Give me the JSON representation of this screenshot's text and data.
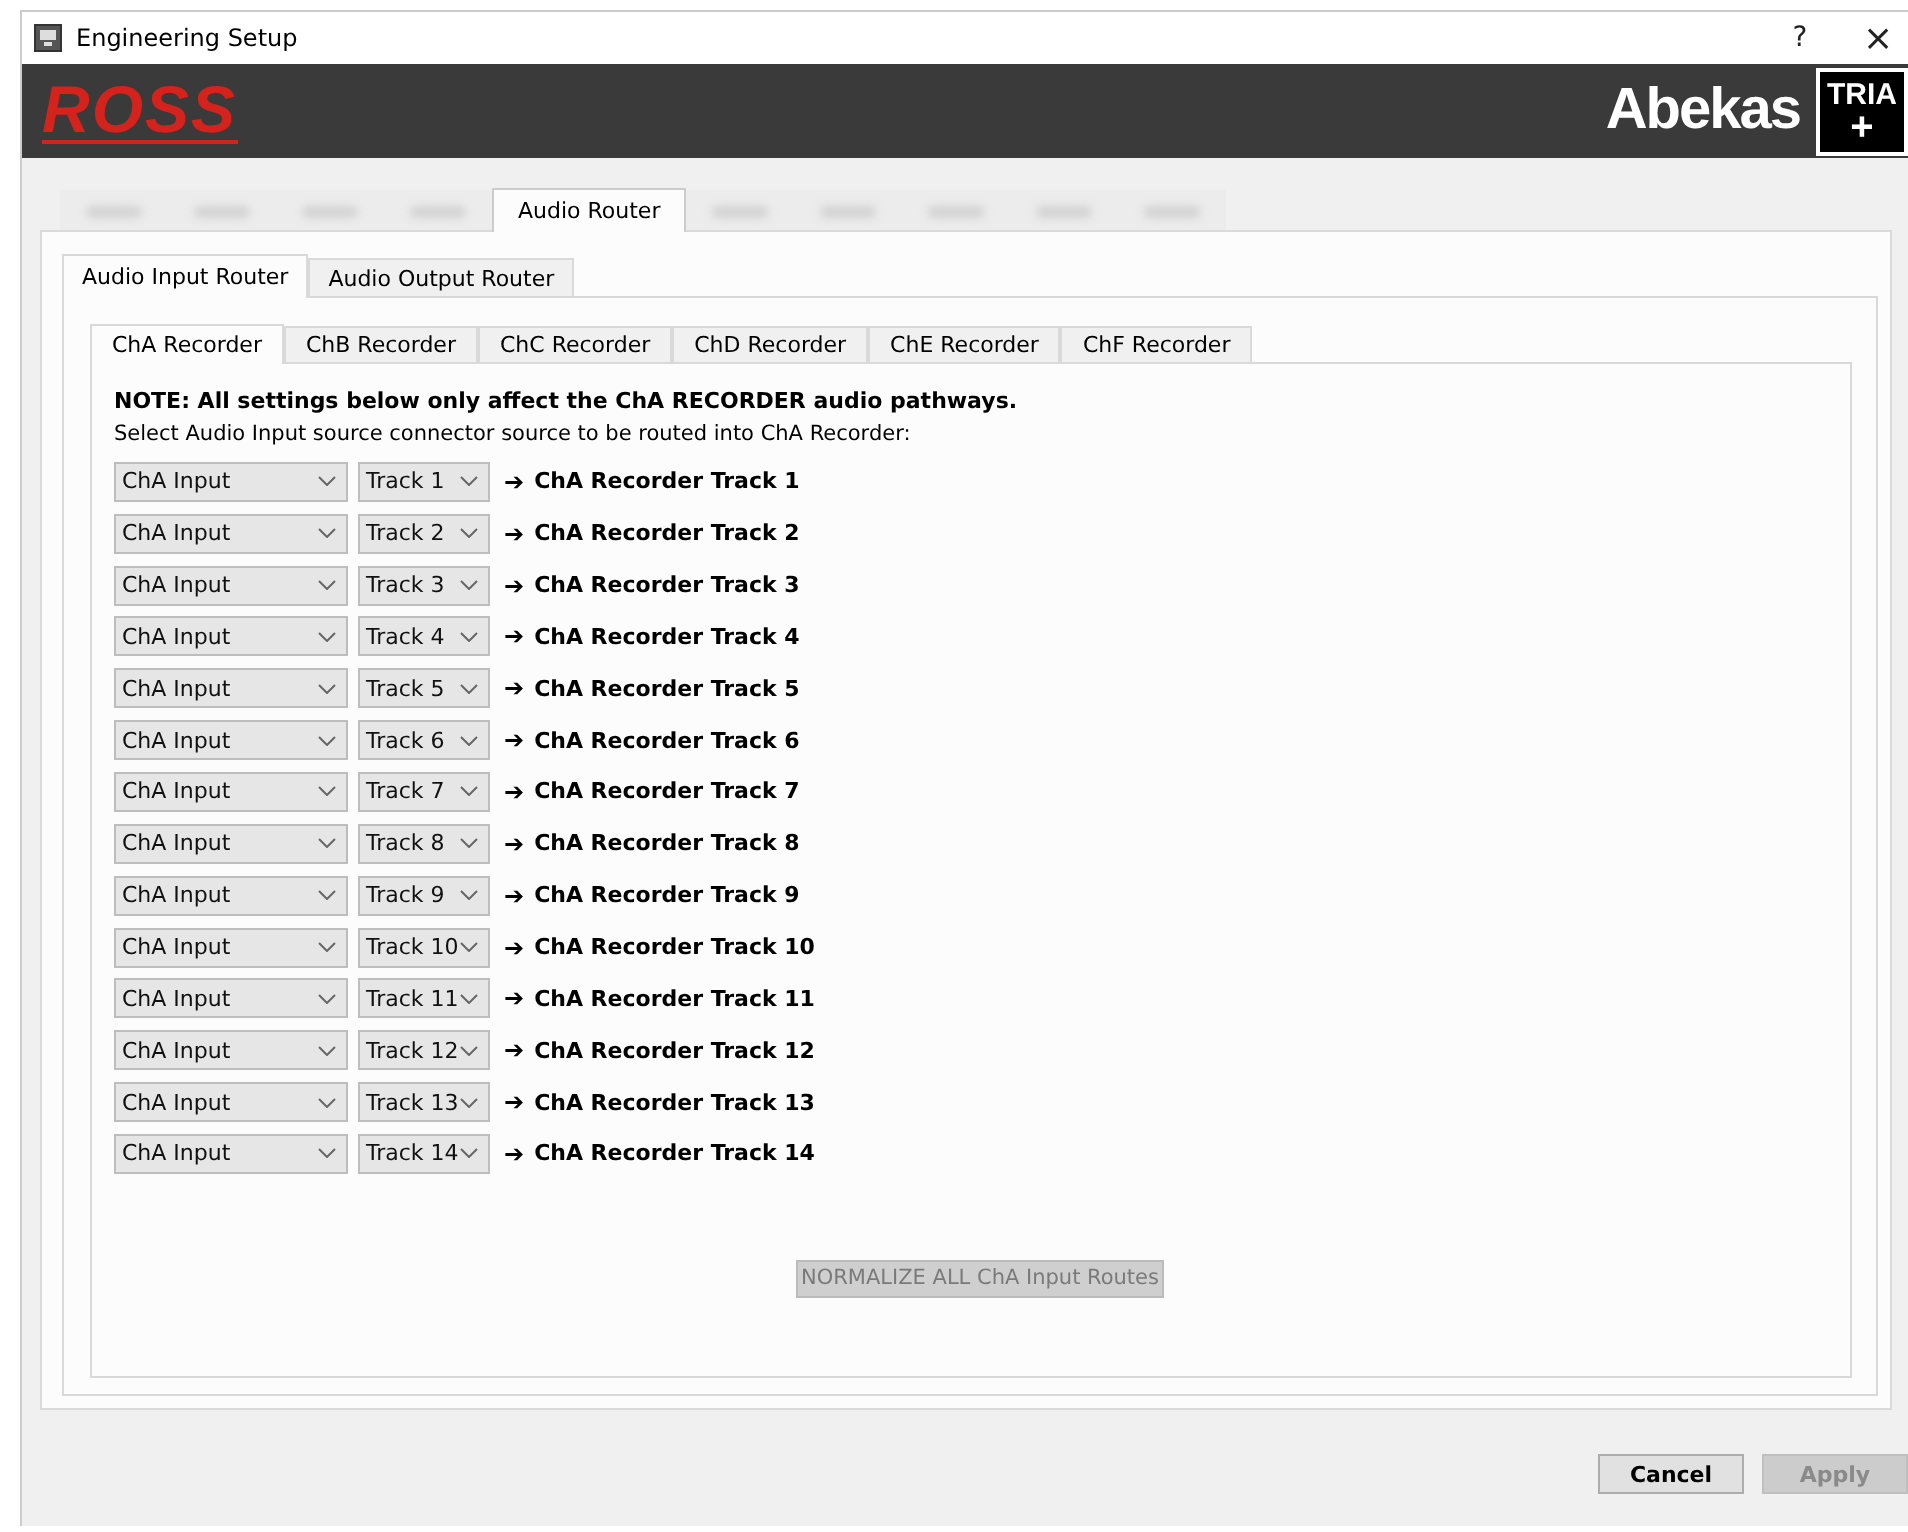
{
  "window": {
    "title": "Engineering Setup",
    "help": "?",
    "close": "×"
  },
  "banner": {
    "left_logo": "ROSS",
    "right_logo": "Abekas",
    "badge_top": "TRIA",
    "badge_bottom": "+"
  },
  "main_tabs": [
    {
      "kind": "blurred",
      "selected": false
    },
    {
      "kind": "blurred",
      "selected": false
    },
    {
      "kind": "blurred",
      "selected": false
    },
    {
      "kind": "blurred",
      "selected": false
    },
    {
      "kind": "text",
      "label": "Audio Router",
      "selected": true
    },
    {
      "kind": "blurred",
      "selected": false
    },
    {
      "kind": "blurred",
      "selected": false
    },
    {
      "kind": "blurred",
      "selected": false
    },
    {
      "kind": "blurred",
      "selected": false
    },
    {
      "kind": "blurred",
      "selected": false
    }
  ],
  "router_tabs": [
    {
      "label": "Audio Input Router",
      "selected": true
    },
    {
      "label": "Audio Output Router",
      "selected": false
    }
  ],
  "recorder_tabs": [
    {
      "label": "ChA Recorder",
      "selected": true
    },
    {
      "label": "ChB Recorder",
      "selected": false
    },
    {
      "label": "ChC Recorder",
      "selected": false
    },
    {
      "label": "ChD Recorder",
      "selected": false
    },
    {
      "label": "ChE Recorder",
      "selected": false
    },
    {
      "label": "ChF Recorder",
      "selected": false
    }
  ],
  "note": "NOTE: All settings below only affect the ChA RECORDER audio pathways.",
  "instruction": "Select Audio Input source connector source to be routed into ChA Recorder:",
  "routes": [
    {
      "source": "ChA Input",
      "track": "Track 1",
      "arrow": "➔",
      "destination": "ChA Recorder Track 1"
    },
    {
      "source": "ChA Input",
      "track": "Track 2",
      "arrow": "➔",
      "destination": "ChA Recorder Track 2"
    },
    {
      "source": "ChA Input",
      "track": "Track 3",
      "arrow": "➔",
      "destination": "ChA Recorder Track 3"
    },
    {
      "source": "ChA Input",
      "track": "Track 4",
      "arrow": "➔",
      "destination": "ChA Recorder Track 4"
    },
    {
      "source": "ChA Input",
      "track": "Track 5",
      "arrow": "➔",
      "destination": "ChA Recorder Track 5"
    },
    {
      "source": "ChA Input",
      "track": "Track 6",
      "arrow": "➔",
      "destination": "ChA Recorder Track 6"
    },
    {
      "source": "ChA Input",
      "track": "Track 7",
      "arrow": "➔",
      "destination": "ChA Recorder Track 7"
    },
    {
      "source": "ChA Input",
      "track": "Track 8",
      "arrow": "➔",
      "destination": "ChA Recorder Track 8"
    },
    {
      "source": "ChA Input",
      "track": "Track 9",
      "arrow": "➔",
      "destination": "ChA Recorder Track 9"
    },
    {
      "source": "ChA Input",
      "track": "Track 10",
      "arrow": "➔",
      "destination": "ChA Recorder Track 10"
    },
    {
      "source": "ChA Input",
      "track": "Track 11",
      "arrow": "➔",
      "destination": "ChA Recorder Track 11"
    },
    {
      "source": "ChA Input",
      "track": "Track 12",
      "arrow": "➔",
      "destination": "ChA Recorder Track 12"
    },
    {
      "source": "ChA Input",
      "track": "Track 13",
      "arrow": "➔",
      "destination": "ChA Recorder Track 13"
    },
    {
      "source": "ChA Input",
      "track": "Track 14",
      "arrow": "➔",
      "destination": "ChA Recorder Track 14"
    }
  ],
  "normalize_button": {
    "label": "NORMALIZE ALL ChA Input Routes",
    "disabled": true
  },
  "footer_buttons": [
    {
      "label": "Cancel",
      "disabled": false
    },
    {
      "label": "Apply",
      "disabled": true
    }
  ]
}
